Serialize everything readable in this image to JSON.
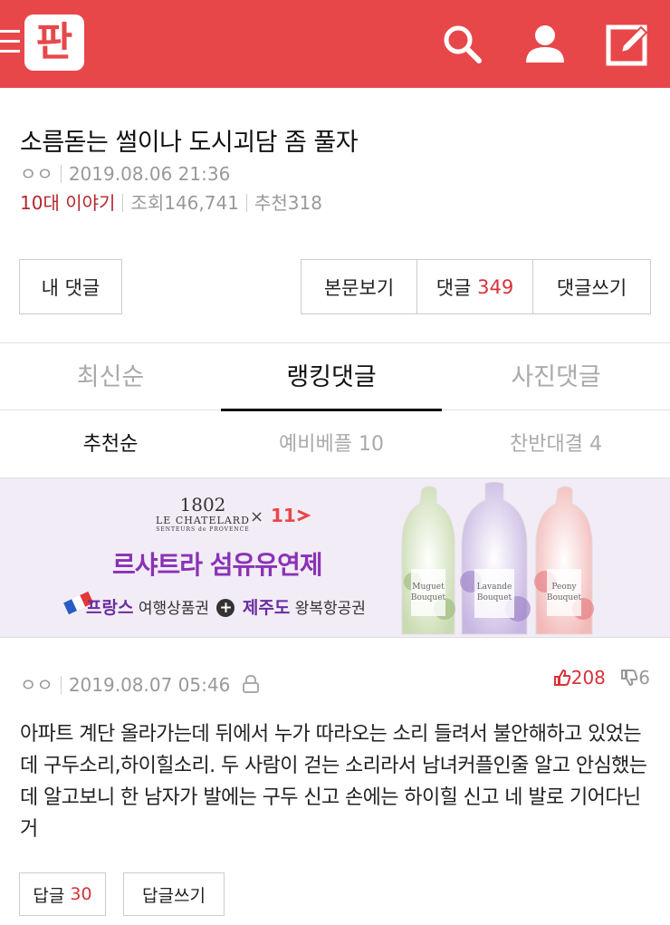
{
  "header": {
    "logo_text": "판",
    "accent_color": "#e8474a",
    "icons": [
      "menu-icon",
      "search-icon",
      "user-icon",
      "write-icon"
    ]
  },
  "post": {
    "title": "소름돋는 썰이나 도시괴담 좀 풀자",
    "author": "ㅇㅇ",
    "datetime": "2019.08.06 21:36",
    "category": "10대 이야기",
    "views_label": "조회",
    "views": "146,741",
    "recommend_label": "추천",
    "recommend": "318"
  },
  "actions": {
    "my_comments": "내 댓글",
    "view_post": "본문보기",
    "comments_label": "댓글",
    "comments_count": "349",
    "write_comment": "댓글쓰기"
  },
  "tabs": {
    "latest": "최신순",
    "ranking": "랭킹댓글",
    "photo": "사진댓글"
  },
  "subtabs": {
    "recommended": "추천순",
    "pre_best_label": "예비베플",
    "pre_best_count": "10",
    "debate_label": "찬반대결",
    "debate_count": "4"
  },
  "banner": {
    "brand_num": "1802",
    "brand_name": "LE CHATELARD",
    "brand_sub": "SENTEURS de PROVENCE",
    "x_mark": "×",
    "partner": "11",
    "headline": "르샤트라 섬유유연제",
    "sub_1": "프랑스",
    "sub_2": "여행상품권",
    "sub_3": "제주도",
    "sub_4": "왕복항공권",
    "bottles": [
      {
        "name_1": "Muguet",
        "name_2": "Bouquet",
        "color": "#9ab87a"
      },
      {
        "name_1": "Lavande",
        "name_2": "Bouquet",
        "color": "#9a7cc4"
      },
      {
        "name_1": "Peony",
        "name_2": "Bouquet",
        "color": "#e4757a"
      }
    ]
  },
  "comment": {
    "author": "ㅇㅇ",
    "datetime": "2019.08.07 05:46",
    "upvotes": "208",
    "downvotes": "6",
    "body": "아파트 계단 올라가는데 뒤에서 누가 따라오는 소리 들려서 불안해하고 있었는데 구두소리,하이힐소리. 두 사람이 걷는 소리라서 남녀커플인줄 알고 안심했는데 알고보니 한 남자가 발에는 구두 신고 손에는 하이힐 신고 네 발로 기어다닌거",
    "reply_label": "답글",
    "reply_count": "30",
    "write_reply": "답글쓰기"
  }
}
